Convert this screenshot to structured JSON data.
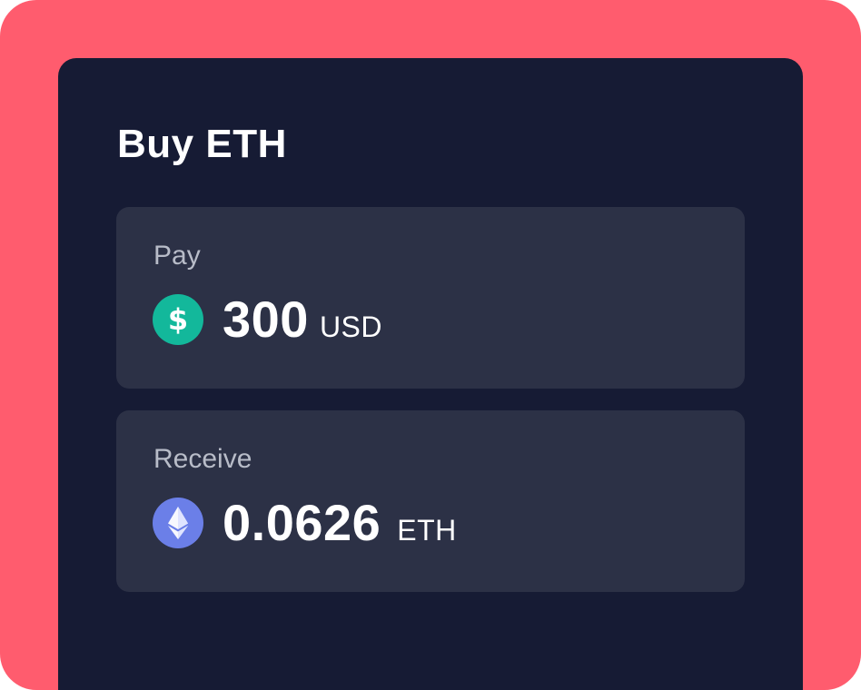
{
  "widget": {
    "title": "Buy ETH",
    "pay": {
      "label": "Pay",
      "amount": "300",
      "currency": "USD",
      "icon": "dollar-coin-icon",
      "icon_color": "#13b89b"
    },
    "receive": {
      "label": "Receive",
      "amount": "0.0626",
      "currency": "ETH",
      "icon": "ethereum-coin-icon",
      "icon_color": "#6b7fe8"
    }
  },
  "colors": {
    "background": "#ff5c6e",
    "panel": "#161b34",
    "card": "#2c3146",
    "label": "#b8bcc8",
    "text": "#ffffff"
  }
}
